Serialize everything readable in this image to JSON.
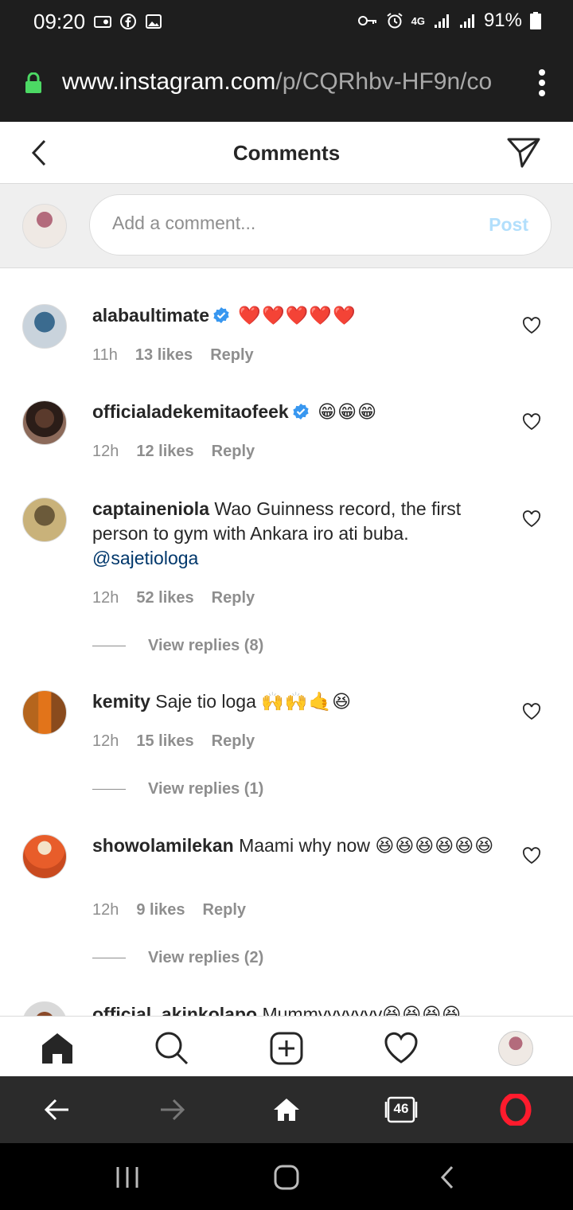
{
  "status_bar": {
    "time": "09:20",
    "battery": "91%",
    "network": "4G"
  },
  "browser": {
    "url_main": "www.instagram.com",
    "url_path": "/p/CQRhbv-HF9n/co",
    "tab_count": "46"
  },
  "header": {
    "title": "Comments"
  },
  "add_comment": {
    "placeholder": "Add a comment...",
    "post_label": "Post"
  },
  "comments": [
    {
      "username": "alabaultimate",
      "verified": true,
      "text": "",
      "emoji": "❤️❤️❤️❤️❤️",
      "time": "11h",
      "likes": "13 likes",
      "reply": "Reply"
    },
    {
      "username": "officialadekemitaofeek",
      "verified": true,
      "text": "",
      "emoji": "😁😁😁",
      "time": "12h",
      "likes": "12 likes",
      "reply": "Reply"
    },
    {
      "username": "captaineniola",
      "verified": false,
      "text": "Wao Guinness record, the first person to gym with Ankara iro ati buba.",
      "mention": "@sajetiologa",
      "time": "12h",
      "likes": "52 likes",
      "reply": "Reply",
      "view_replies": "View replies (8)"
    },
    {
      "username": "kemity",
      "verified": false,
      "text": "Saje tio loga",
      "emoji": "🙌🙌🤙😆",
      "time": "12h",
      "likes": "15 likes",
      "reply": "Reply",
      "view_replies": "View replies (1)"
    },
    {
      "username": "showolamilekan",
      "verified": false,
      "text": "Maami why now",
      "emoji": "😆😆😆😆😆😆",
      "time": "12h",
      "likes": "9 likes",
      "reply": "Reply",
      "view_replies": "View replies (2)"
    },
    {
      "username": "official_akinkolapo",
      "verified": false,
      "text": "Mummyyyyyyy",
      "emoji": "😆😆😆😆"
    }
  ],
  "colors": {
    "accent_blue": "#0095f6",
    "post_disabled": "#b2dffc",
    "muted": "#8e8e8e",
    "verified": "#3897f0",
    "opera_red": "#ff1b2d"
  }
}
